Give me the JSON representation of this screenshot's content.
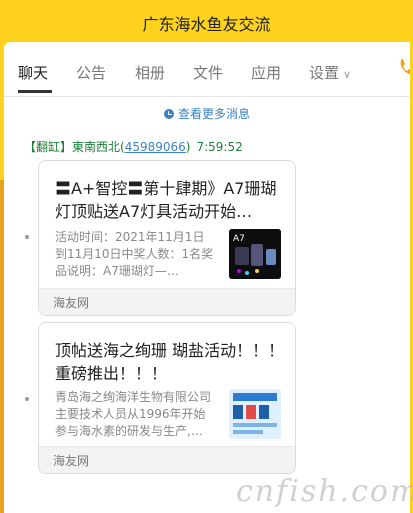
{
  "window": {
    "title": "广东海水鱼友交流"
  },
  "tabs": [
    "聊天",
    "公告",
    "相册",
    "文件",
    "应用",
    "设置"
  ],
  "settings_chevron": "∨",
  "history_link": "查看更多消息",
  "message": {
    "sender_tag": "【翻缸】",
    "sender_name": "東南西北",
    "qq_open": "(",
    "qq_number": "45989066",
    "qq_close": ")",
    "time": "7:59:52"
  },
  "cards": [
    {
      "title": "〓A+智控〓第十肆期》A7珊瑚灯顶贴送A7灯具活动开始…",
      "desc": "活动时间：2021年11月1日到11月10日中奖人数：1名奖品说明：A7珊瑚灯—…",
      "thumb_text": "A7",
      "source": "海友网"
    },
    {
      "title": "顶帖送海之绚珊 瑚盐活动！！！ 重磅推出！！！",
      "desc": "青岛海之绚海洋生物有限公司主要技术人员从1996年开始参与海水素的研发与生产,…",
      "thumb_text": "",
      "source": "海友网"
    }
  ],
  "watermark": "cnfish.com",
  "colors": {
    "accent": "#ffd21e",
    "sender": "#1a7f37",
    "link": "#3b82c4"
  },
  "icons": [
    "phone-icon",
    "clock-icon",
    "chevron-down-icon"
  ]
}
